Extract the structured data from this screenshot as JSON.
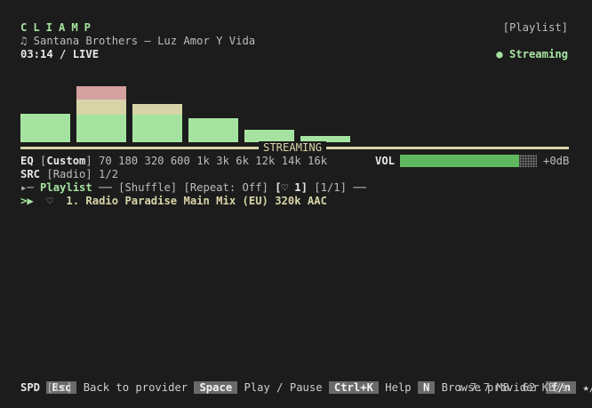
{
  "header": {
    "app_title": "CLIAMP",
    "view_label": "[Playlist]",
    "now_playing": "♫ Santana Brothers – Luz Amor Y Vida",
    "time": "03:14 / LIVE",
    "status_dot": "●",
    "status_text": "Streaming"
  },
  "visualizer": {
    "bands": [
      {
        "green": 0.47,
        "yellow": 0.0,
        "red": 0.0
      },
      {
        "green": 0.45,
        "yellow": 0.25,
        "red": 0.22
      },
      {
        "green": 0.45,
        "yellow": 0.18,
        "red": 0.0
      },
      {
        "green": 0.4,
        "yellow": 0.0,
        "red": 0.0
      },
      {
        "green": 0.21,
        "yellow": 0.0,
        "red": 0.0
      },
      {
        "green": 0.1,
        "yellow": 0.0,
        "red": 0.0
      }
    ],
    "divider_label": "STREAMING"
  },
  "eq": {
    "label": "EQ",
    "preset": "[Custom]",
    "bands": [
      "70",
      "180",
      "320",
      "600",
      "1k",
      "3k",
      "6k",
      "12k",
      "14k",
      "16k"
    ]
  },
  "volume": {
    "label": "VOL",
    "level": 0.87,
    "gain": "+0dB"
  },
  "source": {
    "label": "SRC",
    "value": "[Radio] 1/2"
  },
  "playlist": {
    "prefix": "▸─",
    "title": "Playlist",
    "sep": "──",
    "shuffle": "[Shuffle]",
    "repeat": "[Repeat: Off]",
    "fav": "[♡ 1]",
    "page": "[1/1]",
    "tail": "──",
    "items": [
      {
        "marker": ">▶",
        "heart": "♡",
        "text": "1. Radio Paradise Main Mix (EU) 320k AAC"
      }
    ]
  },
  "footer": {
    "shortcuts": [
      {
        "key": "Esc",
        "desc": "Back to provider"
      },
      {
        "key": "Space",
        "desc": "Play / Pause"
      },
      {
        "key": "Ctrl+K",
        "desc": "Help"
      },
      {
        "key": "N",
        "desc": "Browse provider"
      },
      {
        "key": "f/n",
        "desc": "★/♡"
      }
    ],
    "speed_label": "SPD",
    "speed_value": "[1x]",
    "download": "↓ 7.7 MB",
    "rate": "62 KB/s"
  },
  "colors": {
    "background": "#1c1c1c",
    "accent_green": "#a6e3a1",
    "accent_yellow": "#d7d4a8",
    "peak_red": "#d4a0a0",
    "volume_fill": "#5fb85f"
  }
}
